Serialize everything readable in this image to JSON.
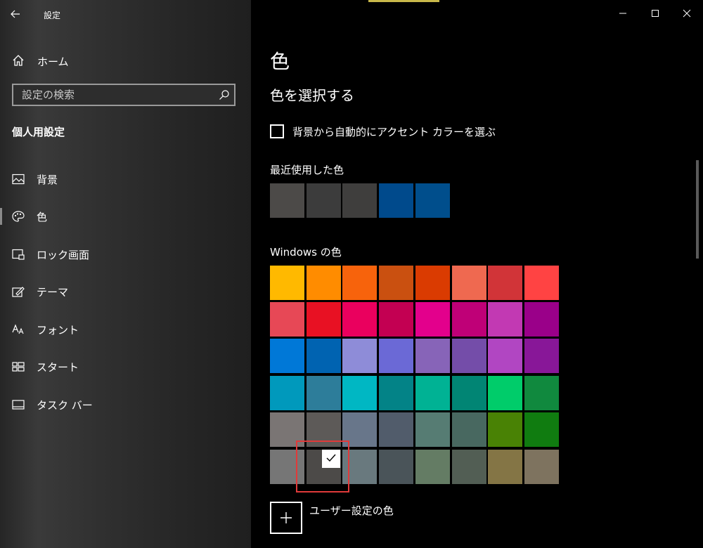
{
  "window": {
    "title": "設定",
    "accent_color": "#c8b84a"
  },
  "nav": {
    "home_label": "ホーム",
    "search_placeholder": "設定の検索",
    "section_title": "個人用設定",
    "items": [
      {
        "label": "背景",
        "icon": "picture-icon"
      },
      {
        "label": "色",
        "icon": "palette-icon",
        "active": true
      },
      {
        "label": "ロック画面",
        "icon": "lock-screen-icon"
      },
      {
        "label": "テーマ",
        "icon": "theme-icon"
      },
      {
        "label": "フォント",
        "icon": "font-icon"
      },
      {
        "label": "スタート",
        "icon": "start-icon"
      },
      {
        "label": "タスク バー",
        "icon": "taskbar-icon"
      }
    ]
  },
  "main": {
    "title": "色",
    "subheading": "色を選択する",
    "auto_accent_label": "背景から自動的にアクセント カラーを選ぶ",
    "auto_accent_checked": false,
    "recent_label": "最近使用した色",
    "recent_colors": [
      "#4c4a48",
      "#3c3c3c",
      "#3f3e3d",
      "#004a8c",
      "#004e8c"
    ],
    "windows_label": "Windows の色",
    "windows_colors": [
      [
        "#ffb900",
        "#ff8c00",
        "#f7630c",
        "#ca5010",
        "#da3b01",
        "#ef6950",
        "#d13438",
        "#ff4343"
      ],
      [
        "#e74856",
        "#e81123",
        "#ea005e",
        "#c30052",
        "#e3008c",
        "#bf0077",
        "#c239b3",
        "#9a0089"
      ],
      [
        "#0078d7",
        "#0063b1",
        "#8e8cd8",
        "#6b69d6",
        "#8764b8",
        "#744da9",
        "#b146c2",
        "#881798"
      ],
      [
        "#0099bc",
        "#2d7d9a",
        "#00b7c3",
        "#038387",
        "#00b294",
        "#018574",
        "#00cc6a",
        "#10893e"
      ],
      [
        "#7a7574",
        "#5d5a58",
        "#68768a",
        "#515c6b",
        "#567c73",
        "#486860",
        "#498205",
        "#107c10"
      ],
      [
        "#767676",
        "#4c4a48",
        "#69797e",
        "#4a5459",
        "#647c64",
        "#525e54",
        "#847545",
        "#7e735f"
      ]
    ],
    "selected_color": "#4c4a48",
    "custom_color_label": "ユーザー設定の色",
    "selection_highlight_color": "#e03a3a"
  }
}
